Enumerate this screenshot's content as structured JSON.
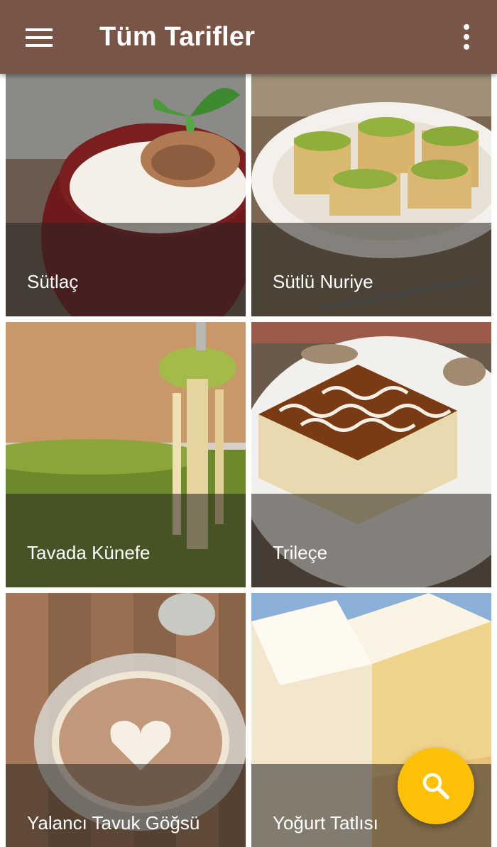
{
  "toolbar": {
    "title": "Tüm Tarifler",
    "menu_icon": "hamburger-menu-icon",
    "overflow_icon": "more-vert-icon",
    "background_color": "#795548"
  },
  "recipes": [
    {
      "name": "Sütlaç"
    },
    {
      "name": "Sütlü Nuriye"
    },
    {
      "name": "Tavada Künefe"
    },
    {
      "name": "Trileçe"
    },
    {
      "name": "Yalancı Tavuk Göğsü"
    },
    {
      "name": "Yoğurt Tatlısı"
    }
  ],
  "fab": {
    "icon": "search-icon",
    "color": "#FFC107"
  }
}
